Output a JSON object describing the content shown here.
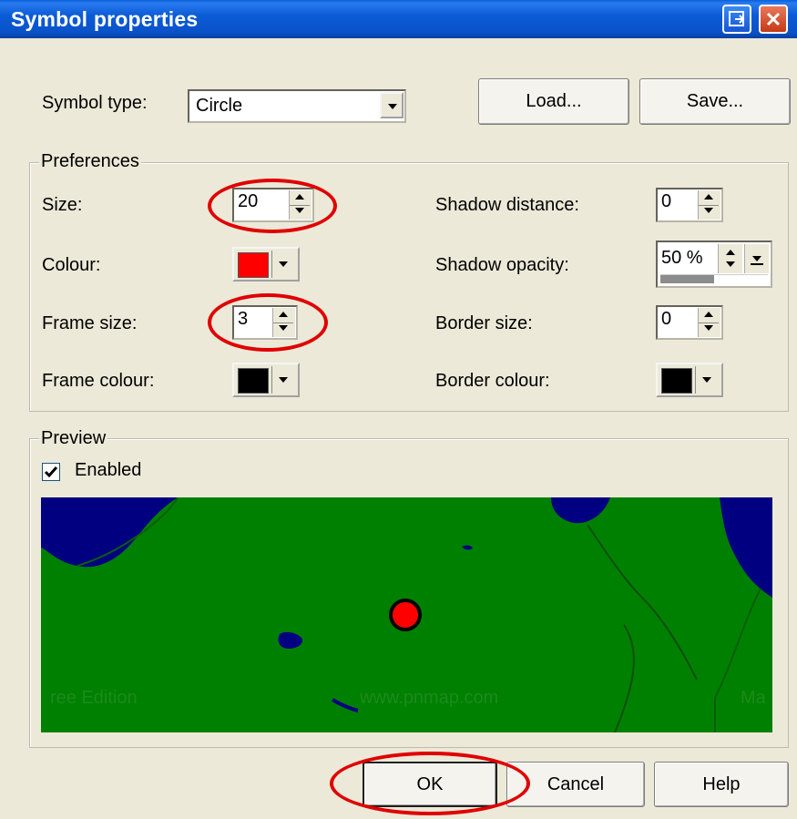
{
  "window": {
    "title": "Symbol properties"
  },
  "symbol_type": {
    "label": "Symbol type:",
    "value": "Circle"
  },
  "buttons": {
    "load": "Load...",
    "save": "Save...",
    "ok": "OK",
    "cancel": "Cancel",
    "help": "Help"
  },
  "preferences": {
    "title": "Preferences",
    "size": {
      "label": "Size:",
      "value": "20"
    },
    "colour": {
      "label": "Colour:",
      "color": "#ff0000"
    },
    "frame_size": {
      "label": "Frame size:",
      "value": "3"
    },
    "frame_colour": {
      "label": "Frame colour:",
      "color": "#000000"
    },
    "shadow_distance": {
      "label": "Shadow distance:",
      "value": "0"
    },
    "shadow_opacity": {
      "label": "Shadow opacity:",
      "value": "50 %",
      "percent": 50
    },
    "border_size": {
      "label": "Border size:",
      "value": "0"
    },
    "border_colour": {
      "label": "Border colour:",
      "color": "#000000"
    }
  },
  "preview": {
    "title": "Preview",
    "enabled_label": "Enabled",
    "enabled": true,
    "watermarks": [
      "ree Edition",
      "www.pnmap.com",
      "Ma"
    ]
  },
  "colors": {
    "land": "#008000",
    "water": "#000080",
    "symbol": "#ff0000",
    "annotation": "#e00000"
  }
}
